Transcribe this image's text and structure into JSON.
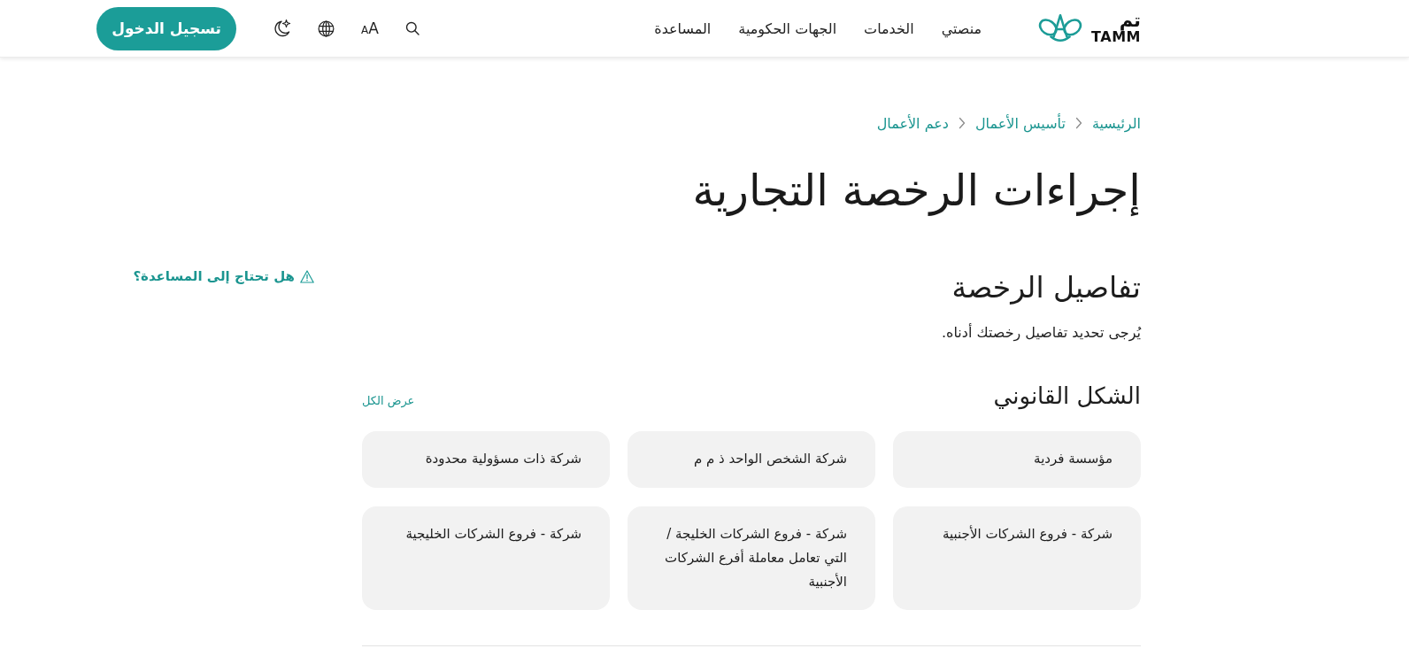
{
  "header": {
    "logo": {
      "arabic": "تم",
      "latin": "TAMM"
    },
    "nav": [
      "منصتي",
      "الخدمات",
      "الجهات الحكومية",
      "المساعدة"
    ],
    "text_size": {
      "small": "A",
      "large": "A"
    },
    "login_button": "تسجيل الدخول"
  },
  "breadcrumb": [
    "الرئيسية",
    "تأسيس الأعمال",
    "دعم الأعمال"
  ],
  "title": "إجراءات الرخصة التجارية",
  "help_link": "هل تحتاج إلى المساعدة؟",
  "section": {
    "title": "تفاصيل الرخصة",
    "subtitle": "يُرجى تحديد تفاصيل رخصتك أدناه."
  },
  "legal_form": {
    "title": "الشكل القانوني",
    "view_all": "عرض الكل",
    "options": [
      "مؤسسة فردية",
      "شركة الشخص الواحد ذ م م",
      "شركة ذات مسؤولية محدودة",
      "شركة - فروع الشركات الأجنبية",
      "شركة - فروع الشركات الخليجة / التي تعامل معاملة أفرع الشركات الأجنبية",
      "شركة - فروع الشركات الخليجية"
    ]
  }
}
